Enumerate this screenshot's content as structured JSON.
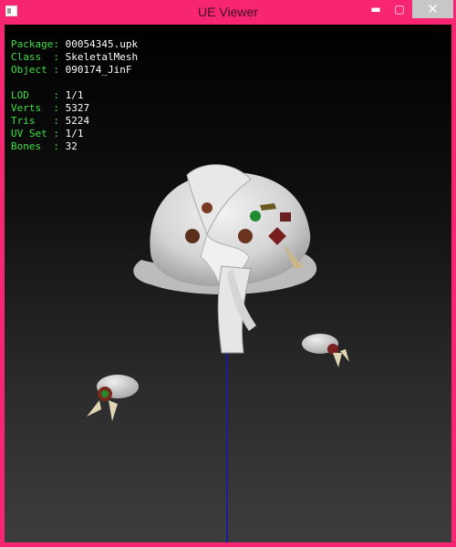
{
  "window": {
    "title": "UE Viewer",
    "controls": {
      "minimize": "▬",
      "maximize": "▢",
      "close": "✕"
    }
  },
  "info": {
    "package": {
      "label": "Package:",
      "value": "00054345.upk"
    },
    "class": {
      "label": "Class  :",
      "value": "SkeletalMesh"
    },
    "object": {
      "label": "Object :",
      "value": "090174_JinF"
    },
    "lod": {
      "label": "LOD    :",
      "value": "1/1"
    },
    "verts": {
      "label": "Verts  :",
      "value": "5327"
    },
    "tris": {
      "label": "Tris   :",
      "value": "5224"
    },
    "uvset": {
      "label": "UV Set :",
      "value": "1/1"
    },
    "bones": {
      "label": "Bones  :",
      "value": "32"
    }
  },
  "colors": {
    "frame": "#f72572",
    "label_text": "#3ee03e",
    "value_text": "#ffffff",
    "axis_line": "#1c1c9c",
    "mesh": "#d9d9d9"
  }
}
